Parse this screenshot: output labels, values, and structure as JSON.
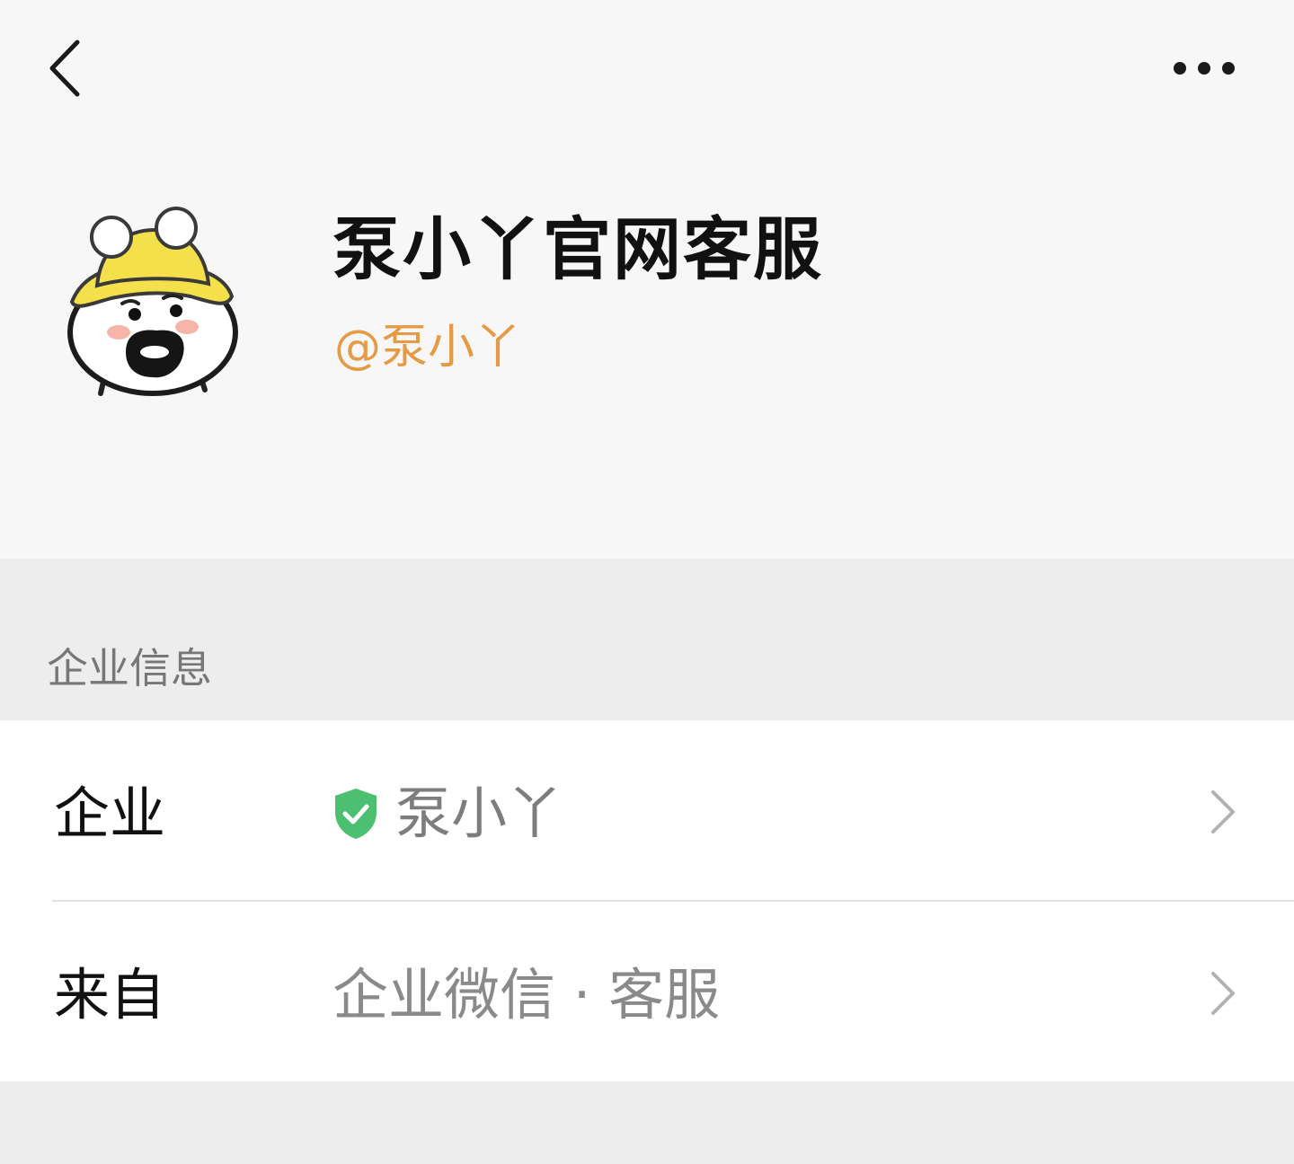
{
  "header": {
    "back_icon": "chevron-left-icon",
    "more_icon": "ellipsis-icon"
  },
  "profile": {
    "name": "泵小丫官网客服",
    "handle": "@泵小丫",
    "handle_color": "#e59a45"
  },
  "section": {
    "title": "企业信息"
  },
  "rows": [
    {
      "label": "企业",
      "value": "泵小丫",
      "icon": "verified-shield-icon",
      "icon_color": "#4cbf70"
    },
    {
      "label": "来自",
      "value": "企业微信 · 客服"
    }
  ]
}
